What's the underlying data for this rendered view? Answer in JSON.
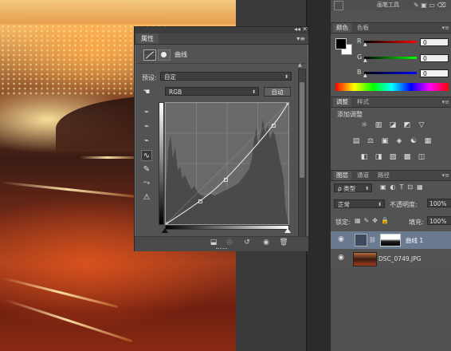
{
  "properties_panel": {
    "tab_label": "属性",
    "collapse_glyph": "◂◂",
    "close_glyph": "✕",
    "menu_glyph": "▾≡",
    "adjustment_title": "曲线",
    "preset_label": "预设:",
    "preset_value": "自定",
    "channel_value": "RGB",
    "auto_button": "自动",
    "tools": [
      "hand-adjust-icon",
      "black-point-eyedropper-icon",
      "gray-point-eyedropper-icon",
      "white-point-eyedropper-icon",
      "curve-edit-icon",
      "pencil-icon",
      "smooth-icon",
      "clipping-warning-icon"
    ],
    "curve_points": [
      {
        "input": 0,
        "output": 0
      },
      {
        "input": 72,
        "output": 48
      },
      {
        "input": 125,
        "output": 93
      },
      {
        "input": 224,
        "output": 207
      },
      {
        "input": 255,
        "output": 255
      }
    ],
    "footer_icons": [
      "clip-to-layer-icon",
      "view-previous-icon",
      "reset-icon",
      "visibility-icon",
      "delete-icon"
    ]
  },
  "color_panel": {
    "tabs": [
      "颜色",
      "色板"
    ],
    "channels": [
      {
        "label": "R",
        "value": "0",
        "color": "#d04040"
      },
      {
        "label": "G",
        "value": "0",
        "color": "#3fa040"
      },
      {
        "label": "B",
        "value": "0",
        "color": "#3a4fd0"
      }
    ]
  },
  "adjustments_panel": {
    "tabs": [
      "调整",
      "样式"
    ],
    "heading": "添加调整",
    "row1": [
      "☼",
      "▥",
      "◪",
      "◩",
      "▽"
    ],
    "row2": [
      "▤",
      "⚖",
      "▣",
      "◈",
      "☯",
      "▦"
    ],
    "row3": [
      "◧",
      "◨",
      "▨",
      "▩",
      "◫"
    ]
  },
  "layers_panel": {
    "tabs": [
      "图层",
      "通道",
      "路径"
    ],
    "filter_kind": "ρ 类型",
    "blend_mode": "正常",
    "opacity_label": "不透明度:",
    "opacity_value": "100%",
    "lock_label": "锁定:",
    "fill_label": "填充:",
    "fill_value": "100%",
    "layers": [
      {
        "name": "曲线 1",
        "selected": true
      },
      {
        "name": "DSC_0749.JPG",
        "selected": false
      }
    ]
  },
  "top_dock": {
    "partial_label": "画笔工具"
  }
}
